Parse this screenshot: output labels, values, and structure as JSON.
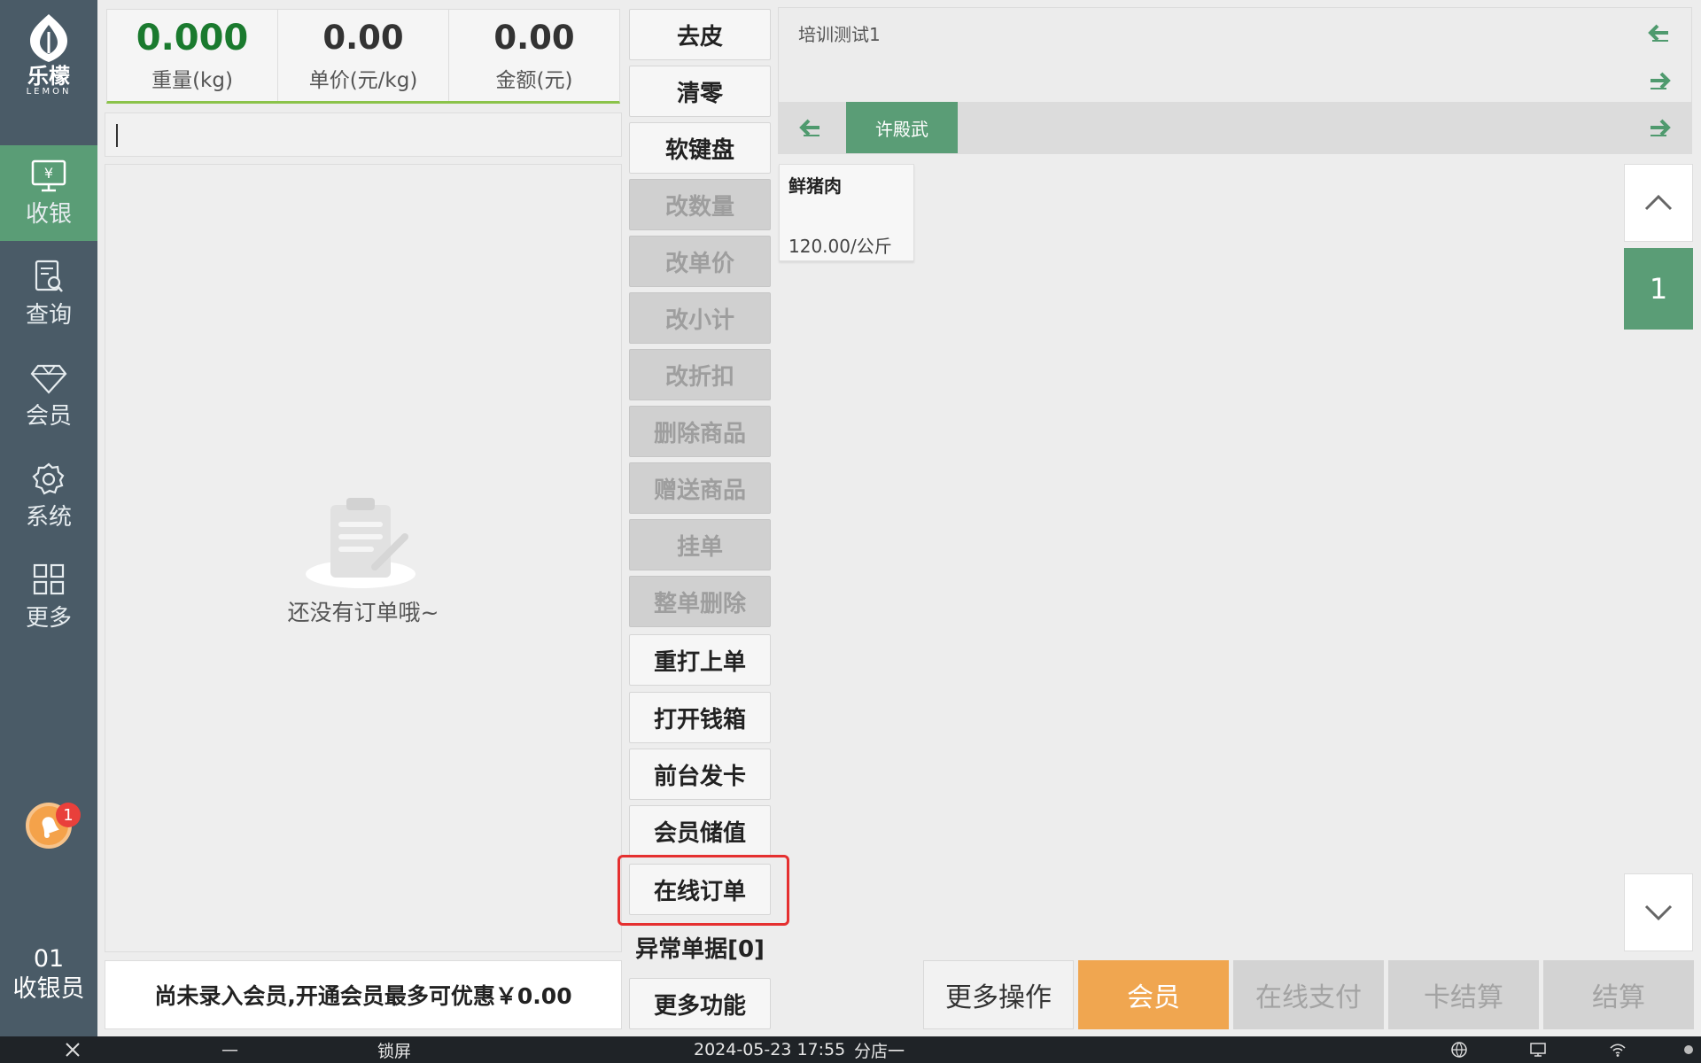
{
  "brand": {
    "name_cn": "乐檬",
    "name_en": "LEMON"
  },
  "sidebar": {
    "items": [
      {
        "label": "收银",
        "icon": "cashier-icon",
        "active": true
      },
      {
        "label": "查询",
        "icon": "search-doc-icon"
      },
      {
        "label": "会员",
        "icon": "diamond-icon"
      },
      {
        "label": "系统",
        "icon": "gear-icon"
      },
      {
        "label": "更多",
        "icon": "grid-icon"
      }
    ],
    "notification_count": "1",
    "cashier_id": "01",
    "cashier_role": "收银员"
  },
  "scale": {
    "weight_value": "0.000",
    "weight_label": "重量(kg)",
    "unit_price_value": "0.00",
    "unit_price_label": "单价(元/kg)",
    "amount_value": "0.00",
    "amount_label": "金额(元)"
  },
  "order": {
    "empty_text": "还没有订单哦~",
    "member_hint": "尚未录入会员,开通会员最多可优惠￥0.00"
  },
  "functions": [
    {
      "label": "去皮",
      "enabled": true
    },
    {
      "label": "清零",
      "enabled": true
    },
    {
      "label": "软键盘",
      "enabled": true
    },
    {
      "label": "改数量",
      "enabled": false
    },
    {
      "label": "改单价",
      "enabled": false
    },
    {
      "label": "改小计",
      "enabled": false
    },
    {
      "label": "改折扣",
      "enabled": false
    },
    {
      "label": "删除商品",
      "enabled": false
    },
    {
      "label": "赠送商品",
      "enabled": false
    },
    {
      "label": "挂单",
      "enabled": false
    },
    {
      "label": "整单删除",
      "enabled": false
    },
    {
      "label": "重打上单",
      "enabled": true
    },
    {
      "label": "打开钱箱",
      "enabled": true
    },
    {
      "label": "前台发卡",
      "enabled": true
    },
    {
      "label": "会员储值",
      "enabled": true
    },
    {
      "label": "在线订单",
      "enabled": true,
      "highlighted": true
    },
    {
      "label": "异常单据[0]",
      "enabled": true
    },
    {
      "label": "更多功能",
      "enabled": true
    }
  ],
  "category": {
    "title": "培训测试1",
    "sub_tabs": [
      {
        "label": "许殿武",
        "active": true
      }
    ]
  },
  "products": [
    {
      "name": "鲜猪肉",
      "price": "120.00/公斤"
    }
  ],
  "pagination": {
    "current_page": "1"
  },
  "actions": {
    "more": "更多操作",
    "member": "会员",
    "online_pay": "在线支付",
    "card_settle": "卡结算",
    "settle": "结算"
  },
  "statusbar": {
    "minimize": "—",
    "lock": "锁屏",
    "datetime": "2024-05-23 17:55",
    "store": "分店一"
  },
  "colors": {
    "sidebar": "#4a5b67",
    "accent_green": "#5a9d76",
    "member_orange": "#f0a650",
    "highlight_red": "#e53030"
  }
}
